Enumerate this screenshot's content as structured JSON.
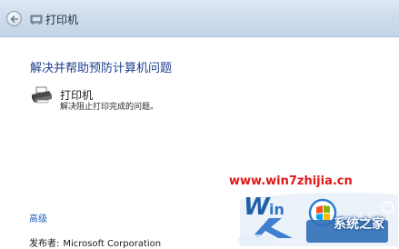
{
  "window": {
    "title": "打印机"
  },
  "content": {
    "heading": "解决并帮助预防计算机问题",
    "item": {
      "name": "打印机",
      "description": "解决阻止打印完成的问题。"
    },
    "advanced_link": "高级",
    "publisher_label": "发布者:",
    "publisher_value": "Microsoft Corporation"
  },
  "watermark": {
    "url": "www.win7zhijia.cn",
    "site_name": "系统之家"
  },
  "icons": {
    "back": "back-arrow-icon",
    "title": "troubleshoot-icon",
    "item": "printer-icon"
  },
  "colors": {
    "heading": "#1e3f8f",
    "link": "#1e5ebd",
    "watermark_url": "#e01818",
    "titlebar": "#cfdcec"
  }
}
